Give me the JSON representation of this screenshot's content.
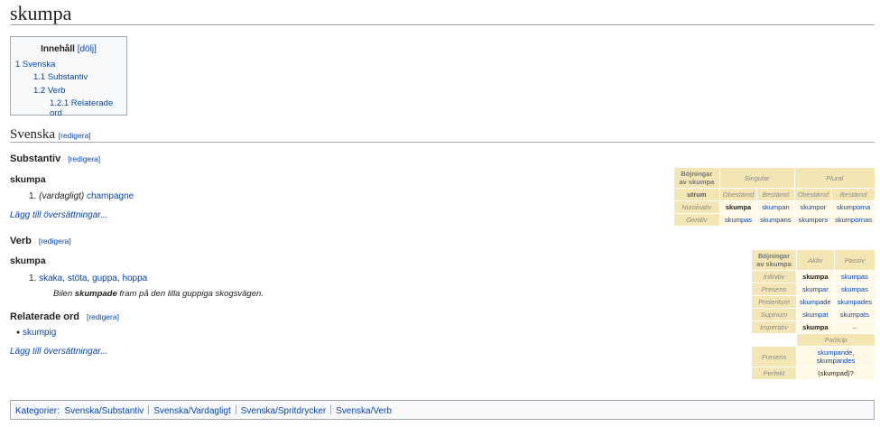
{
  "title": "skumpa",
  "toc": {
    "title": "Innehåll",
    "toggle": "[dölj]",
    "items": [
      "1 Svenska",
      "1.1 Substantiv",
      "1.2 Verb",
      "1.2.1 Relaterade ord"
    ]
  },
  "section": {
    "heading": "Svenska",
    "edit": "[redigera]"
  },
  "noun": {
    "heading": "Substantiv",
    "edit": "[redigera]",
    "word": "skumpa",
    "def_num": "1.",
    "def_label": "(vardagligt)",
    "def_link": "champagne",
    "add_translations": "Lägg till översättningar..."
  },
  "verb": {
    "heading": "Verb",
    "edit": "[redigera]",
    "word": "skumpa",
    "def_num": "1.",
    "def_links": [
      "skaka",
      "stöta",
      "guppa",
      "hoppa"
    ],
    "example_pre": "Bilen ",
    "example_bold": "skumpade",
    "example_post": " fram på den lilla guppiga skogsvägen."
  },
  "related": {
    "heading": "Relaterade ord",
    "edit": "[redigera]",
    "item": "skumpig",
    "add_translations": "Lägg till översättningar..."
  },
  "noun_table": {
    "header": "Böjningar av skumpa",
    "singular": "Singular",
    "plural": "Plural",
    "gender": "utrum",
    "cols": [
      "Obestämd",
      "Bestämd",
      "Obestämd",
      "Bestämd"
    ],
    "rows": [
      {
        "label": "Nominativ",
        "cells": [
          "skumpa",
          "skumpan",
          "skumpor",
          "skumporna"
        ]
      },
      {
        "label": "Genitiv",
        "cells": [
          "skumpas",
          "skumpans",
          "skumpors",
          "skumpornas"
        ]
      }
    ]
  },
  "verb_table": {
    "header": "Böjningar av skumpa",
    "aktiv": "Aktiv",
    "passiv": "Passiv",
    "rows": [
      {
        "label": "Infinitiv",
        "aktiv": "skumpa",
        "passiv": "skumpas"
      },
      {
        "label": "Presens",
        "aktiv": "skumpar",
        "passiv": "skumpas"
      },
      {
        "label": "Preteritum",
        "aktiv": "skumpade",
        "passiv": "skumpades"
      },
      {
        "label": "Supinum",
        "aktiv": "skumpat",
        "passiv": "skumpats"
      },
      {
        "label": "Imperativ",
        "aktiv": "skumpa",
        "passiv": "–"
      }
    ],
    "particip": "Particip",
    "presens_label": "Presens",
    "presens_value": "skumpande, skumpandes",
    "perfekt_label": "Perfekt",
    "perfekt_value": "(skumpad)?"
  },
  "categories": {
    "label": "Kategorier:",
    "items": [
      "Svenska/Substantiv",
      "Svenska/Vardagligt",
      "Svenska/Spritdrycker",
      "Svenska/Verb"
    ]
  }
}
